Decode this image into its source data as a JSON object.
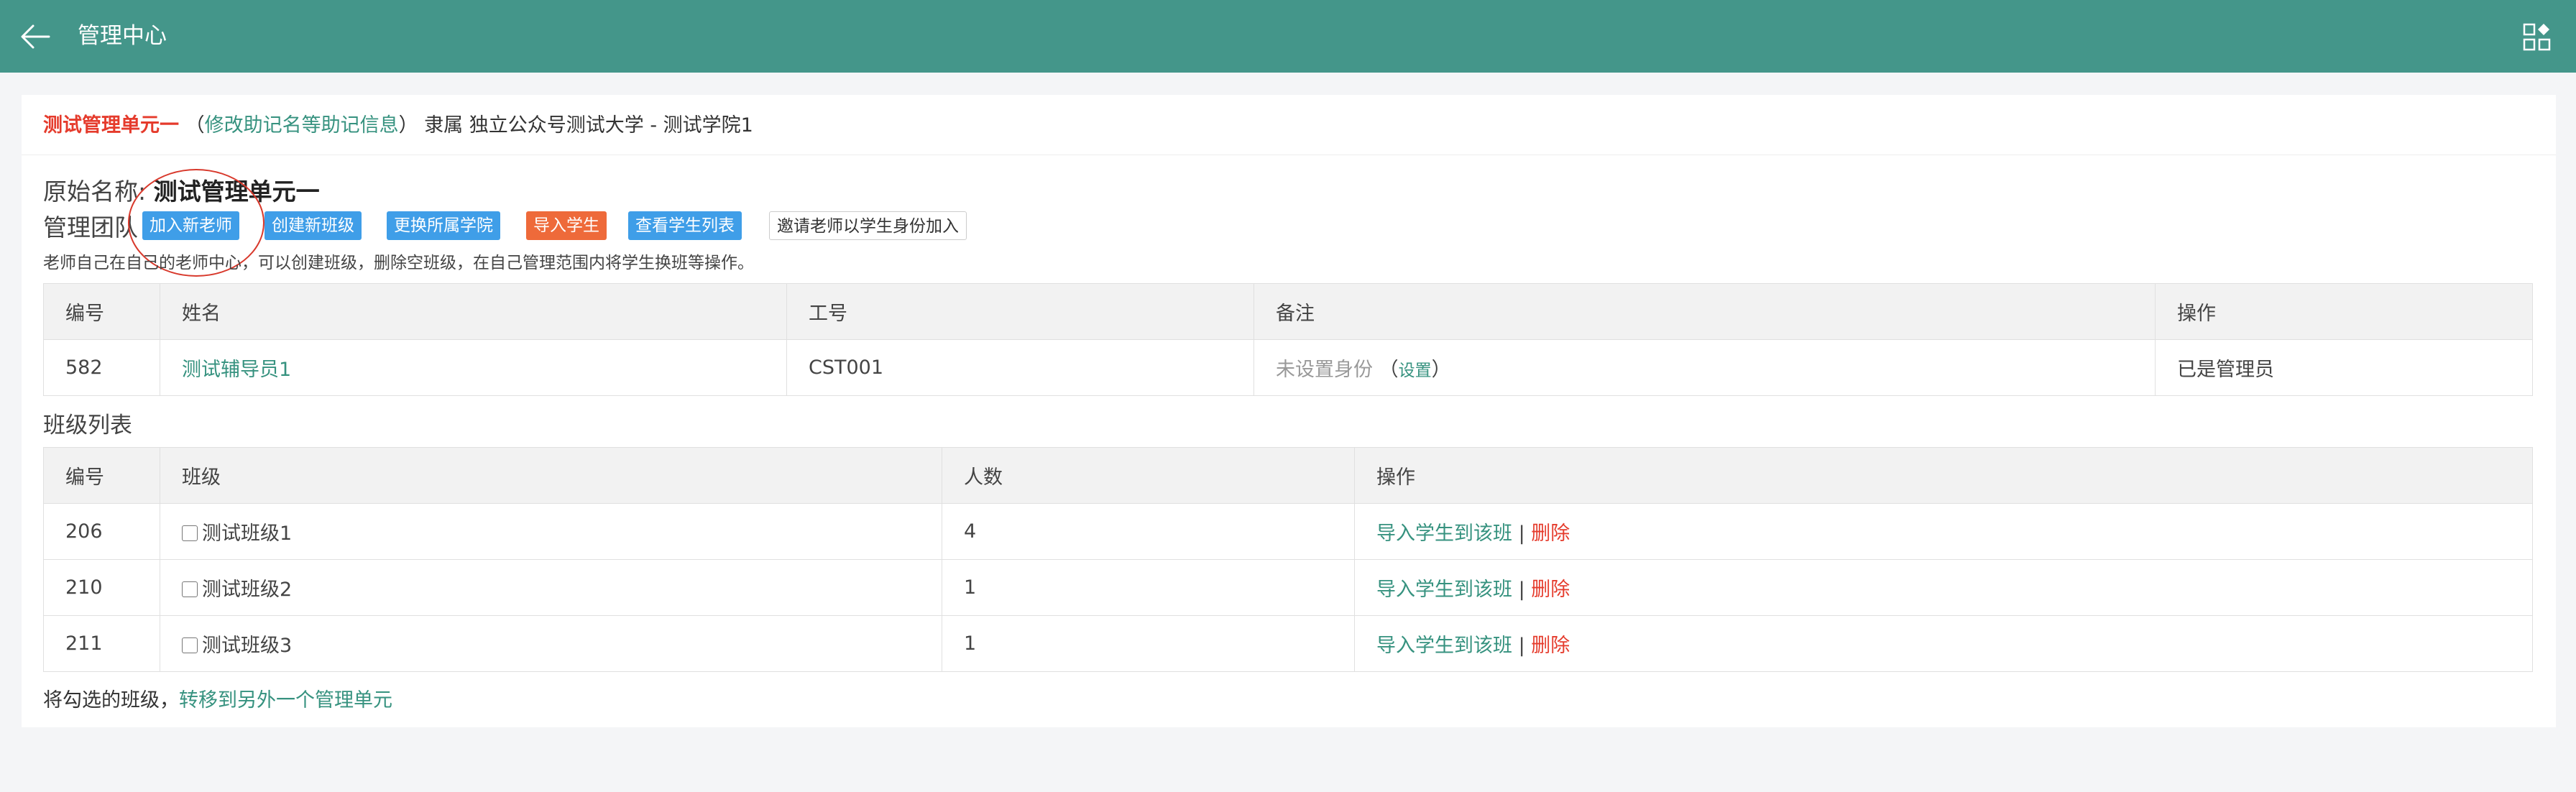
{
  "topbar": {
    "title": "管理中心",
    "back_icon": "arrow-left-icon",
    "apps_icon": "grid-apps-icon",
    "bg_color": "#44968a"
  },
  "header": {
    "unit_name": "测试管理单元一",
    "paren_open": "（",
    "edit_link": "修改助记名等助记信息",
    "paren_close": "）",
    "belongs": "隶属 独立公众号测试大学 - 测试学院1"
  },
  "info": {
    "orig_label": "原始名称:",
    "orig_value": "测试管理单元一",
    "team_label": "管理团队"
  },
  "buttons": {
    "add_teacher": "加入新老师",
    "create_class": "创建新班级",
    "change_college": "更换所属学院",
    "import_students": "导入学生",
    "view_students": "查看学生列表",
    "invite_teacher": "邀请老师以学生身份加入"
  },
  "hint": "老师自己在自己的老师中心，可以创建班级，删除空班级，在自己管理范围内将学生换班等操作。",
  "team_table": {
    "headers": [
      "编号",
      "姓名",
      "工号",
      "备注",
      "操作"
    ],
    "rows": [
      {
        "id": "582",
        "name": "测试辅导员1",
        "job_no": "CST001",
        "note": "未设置身份",
        "note_paren_open": "（",
        "note_link": "设置",
        "note_paren_close": "）",
        "action": "已是管理员"
      }
    ]
  },
  "class_section_title": "班级列表",
  "class_table": {
    "headers": [
      "编号",
      "班级",
      "人数",
      "操作"
    ],
    "rows": [
      {
        "id": "206",
        "name": "测试班级1",
        "count": "4",
        "import": "导入学生到该班",
        "sep": "|",
        "delete": "删除"
      },
      {
        "id": "210",
        "name": "测试班级2",
        "count": "1",
        "import": "导入学生到该班",
        "sep": "|",
        "delete": "删除"
      },
      {
        "id": "211",
        "name": "测试班级3",
        "count": "1",
        "import": "导入学生到该班",
        "sep": "|",
        "delete": "删除"
      }
    ]
  },
  "footer": {
    "prefix": "将勾选的班级，",
    "link": "转移到另外一个管理单元"
  }
}
